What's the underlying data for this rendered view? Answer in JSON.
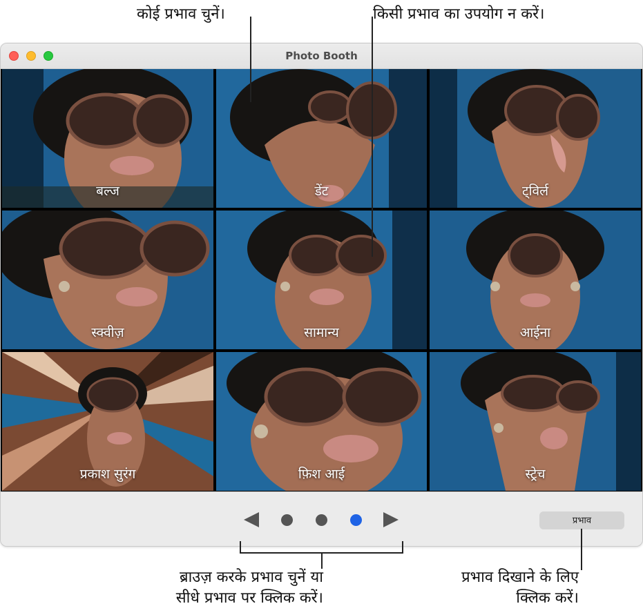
{
  "callouts": {
    "choose_effect": "कोई प्रभाव चुनें।",
    "no_effect": "किसी प्रभाव का उपयोग न करें।",
    "browse_line1": "ब्राउज़ करके प्रभाव चुनें या",
    "browse_line2": "सीधे प्रभाव पर क्लिक करें।",
    "show_effects_line1": "प्रभाव दिखाने के लिए",
    "show_effects_line2": "क्लिक करें।"
  },
  "window": {
    "title": "Photo Booth"
  },
  "effects": [
    {
      "label": "बल्ज",
      "icon": "bulge-preview"
    },
    {
      "label": "डेंट",
      "icon": "dent-preview"
    },
    {
      "label": "ट्विर्ल",
      "icon": "twirl-preview"
    },
    {
      "label": "स्क्वीज़",
      "icon": "squeeze-preview"
    },
    {
      "label": "सामान्य",
      "icon": "normal-preview"
    },
    {
      "label": "आईना",
      "icon": "mirror-preview"
    },
    {
      "label": "प्रकाश सुरंग",
      "icon": "light-tunnel-preview"
    },
    {
      "label": "फ़िश आई",
      "icon": "fish-eye-preview"
    },
    {
      "label": "स्ट्रेच",
      "icon": "stretch-preview"
    }
  ],
  "pager": {
    "pages": 3,
    "current_page": 3
  },
  "effects_button": {
    "label": "प्रभाव"
  },
  "colors": {
    "accent_dot": "#1f63e5",
    "close": "#ff5f57",
    "minimize": "#febc2e",
    "maximize": "#28c840"
  }
}
